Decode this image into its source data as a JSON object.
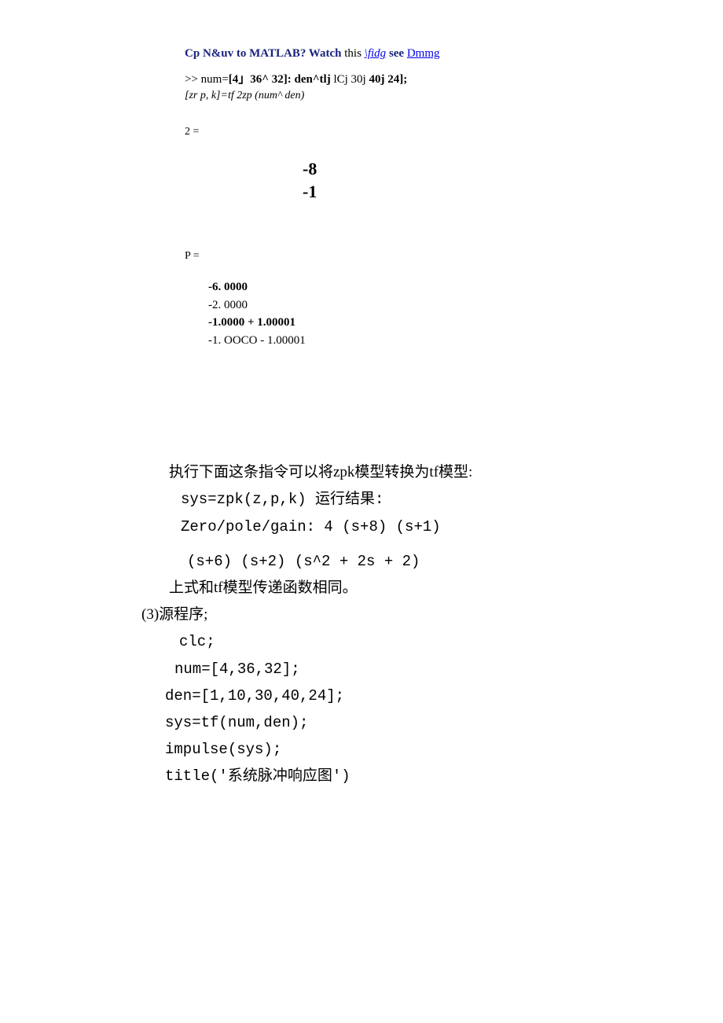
{
  "header": {
    "cp": "Cp",
    "navuv": "N&uv to MATLAB? Watch",
    "watch": "this",
    "fidg": "\\fidg",
    "see": "see",
    "dmmg": "Dmmg"
  },
  "cmd": {
    "line1_prefix": " >> num=",
    "line1_bold1": "[4」36^ 32]: den^tlj",
    "line1_mid": " lCj 30j ",
    "line1_bold2": "40j 24];",
    "line2": "[zr p, k]=tf 2zp (num^ den)"
  },
  "z": {
    "label": "2 =",
    "v1": "-8",
    "v2": "-1"
  },
  "p": {
    "label": "P =",
    "v1": "-6. 0000",
    "v2": "-2. 0000",
    "v3": "-1.0000 + 1.00001",
    "v4": "-1. OOCO - 1.00001"
  },
  "bottom": {
    "line1": "执行下面这条指令可以将zpk模型转换为tf模型:",
    "code1": "sys=zpk(z,p,k) 运行结果:",
    "code2": "Zero/pole/gain: 4 (s+8) (s+1)",
    "code3": "(s+6) (s+2) (s^2 + 2s + 2)",
    "line2": "上式和tf模型传递函数相同。",
    "line3": "(3)源程序;",
    "code4": "clc;",
    "code5": "num=[4,36,32];",
    "code6": "den=[1,10,30,40,24];",
    "code7": "sys=tf(num,den);",
    "code8": "impulse(sys);",
    "code9": "title('系统脉冲响应图')"
  }
}
